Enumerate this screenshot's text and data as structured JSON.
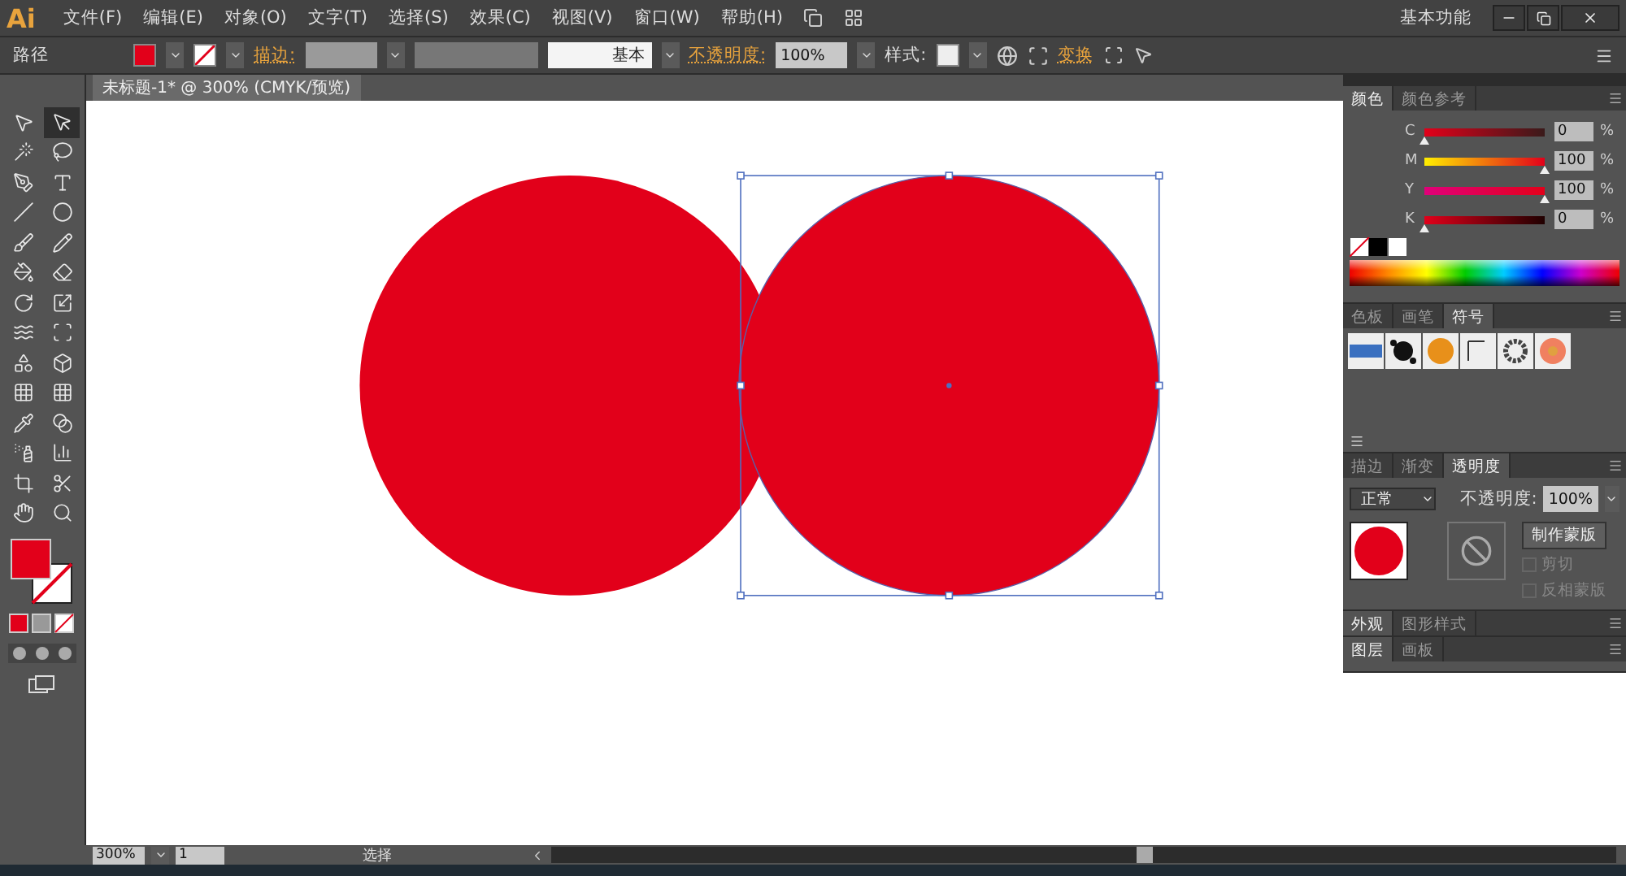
{
  "app": {
    "logo": "Ai",
    "menu": [
      "文件(F)",
      "编辑(E)",
      "对象(O)",
      "文字(T)",
      "选择(S)",
      "效果(C)",
      "视图(V)",
      "窗口(W)",
      "帮助(H)"
    ],
    "workspace": "基本功能"
  },
  "control_bar": {
    "object_label": "路径",
    "stroke_label": "描边:",
    "line_style": "基本",
    "opacity_label": "不透明度:",
    "opacity_value": "100%",
    "style_label": "样式:",
    "transform_label": "变换"
  },
  "document_tab": {
    "title": "未标题-1* @ 300% (CMYK/预览)"
  },
  "tools": [
    {
      "kind": "select",
      "selected": false
    },
    {
      "kind": "direct",
      "selected": true
    },
    {
      "kind": "wand",
      "selected": false
    },
    {
      "kind": "lasso",
      "selected": false
    },
    {
      "kind": "pen",
      "selected": false
    },
    {
      "kind": "type",
      "selected": false
    },
    {
      "kind": "line",
      "selected": false
    },
    {
      "kind": "ellipse",
      "selected": false
    },
    {
      "kind": "brush",
      "selected": false
    },
    {
      "kind": "pencil",
      "selected": false
    },
    {
      "kind": "blob",
      "selected": false
    },
    {
      "kind": "eraser",
      "selected": false
    },
    {
      "kind": "rotate",
      "selected": false
    },
    {
      "kind": "scale",
      "selected": false
    },
    {
      "kind": "warp",
      "selected": false
    },
    {
      "kind": "free",
      "selected": false
    },
    {
      "kind": "builder",
      "selected": false
    },
    {
      "kind": "perspective",
      "selected": false
    },
    {
      "kind": "mesh",
      "selected": false
    },
    {
      "kind": "gradient",
      "selected": false
    },
    {
      "kind": "eyedropper",
      "selected": false
    },
    {
      "kind": "blend",
      "selected": false
    },
    {
      "kind": "spray",
      "selected": false
    },
    {
      "kind": "graph",
      "selected": false
    },
    {
      "kind": "artboard",
      "selected": false
    },
    {
      "kind": "slice",
      "selected": false
    },
    {
      "kind": "hand",
      "selected": false
    },
    {
      "kind": "zoom",
      "selected": false
    }
  ],
  "color_panel": {
    "tabs": [
      {
        "label": "颜色",
        "selected": true
      },
      {
        "label": "颜色参考",
        "selected": false
      }
    ],
    "sliders": [
      {
        "label": "C",
        "value": "0",
        "unit": "%",
        "level": 0
      },
      {
        "label": "M",
        "value": "100",
        "unit": "%",
        "level": 1
      },
      {
        "label": "Y",
        "value": "100",
        "unit": "%",
        "level": 1
      },
      {
        "label": "K",
        "value": "0",
        "unit": "%",
        "level": 0
      }
    ]
  },
  "symbols_panel": {
    "tabs": [
      {
        "label": "色板",
        "selected": false
      },
      {
        "label": "画笔",
        "selected": false
      },
      {
        "label": "符号",
        "selected": true
      }
    ]
  },
  "transparency_panel": {
    "tabs": [
      {
        "label": "描边",
        "selected": false
      },
      {
        "label": "渐变",
        "selected": false
      },
      {
        "label": "透明度",
        "selected": true
      }
    ],
    "blend_mode": "正常",
    "opacity_label": "不透明度:",
    "opacity_value": "100%",
    "mask_button": "制作蒙版",
    "options": [
      {
        "label": "剪切",
        "checked": false
      },
      {
        "label": "反相蒙版",
        "checked": false
      }
    ]
  },
  "appearance_panel": {
    "tabs": [
      {
        "label": "外观",
        "selected": true
      },
      {
        "label": "图形样式",
        "selected": false
      }
    ]
  },
  "layers_panel": {
    "tabs": [
      {
        "label": "图层",
        "selected": true
      },
      {
        "label": "画板",
        "selected": false
      }
    ]
  },
  "status_bar": {
    "zoom": "300%",
    "page": "1",
    "tool": "选择"
  }
}
